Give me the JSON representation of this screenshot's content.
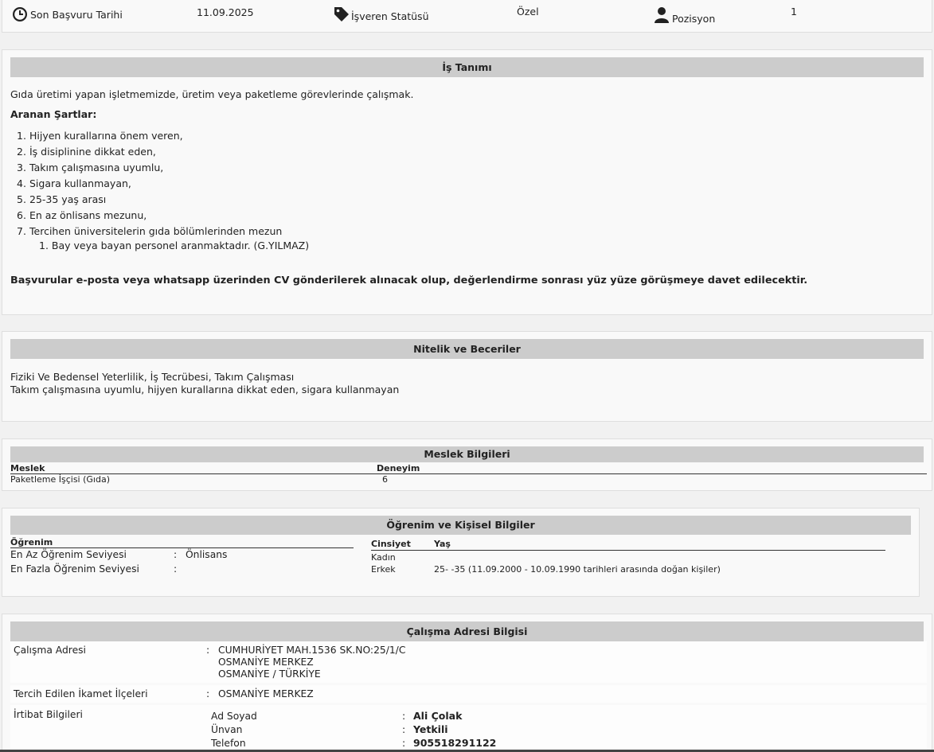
{
  "top_info": {
    "deadline_label": "Son Başvuru Tarihi",
    "deadline_value": "11.09.2025",
    "employer_status_label": "İşveren Statüsü",
    "employer_status_value": "Özel",
    "position_label": "Pozisyon",
    "position_value": "1",
    "icons": [
      "clock-icon",
      "tag-icon",
      "user-icon"
    ]
  },
  "job_description": {
    "title": "İş Tanımı",
    "intro": "Gıda üretimi yapan işletmemizde, üretim veya paketleme görevlerinde çalışmak.",
    "requirements_title": "Aranan Şartlar:",
    "requirements": [
      {
        "n": "1.",
        "text": "Hijyen kurallarına önem veren,"
      },
      {
        "n": "2.",
        "text": "İş disiplinine dikkat eden,"
      },
      {
        "n": "3.",
        "text": "Takım çalışmasına uyumlu,"
      },
      {
        "n": "4.",
        "text": "Sigara kullanmayan,"
      },
      {
        "n": "5.",
        "text": "25-35 yaş arası"
      },
      {
        "n": "6.",
        "text": "En az önlisans mezunu,"
      },
      {
        "n": "7.",
        "text": "Tercihen üniversitelerin gıda bölümlerinden mezun"
      }
    ],
    "sub_requirement": "1. Bay veya bayan personel aranmaktadır. (G.YILMAZ)",
    "closing": "Başvurular e-posta veya whatsapp üzerinden CV gönderilerek alınacak olup, değerlendirme sonrası yüz yüze görüşmeye davet edilecektir."
  },
  "skills": {
    "title": "Nitelik ve Beceriler",
    "line1": "Fiziki Ve Bedensel Yeterlilik, İş Tecrübesi, Takım Çalışması",
    "line2": "Takım çalışmasına uyumlu, hijyen kurallarına dikkat eden, sigara kullanmayan"
  },
  "occupation": {
    "title": "Meslek Bilgileri",
    "col_occupation": "Meslek",
    "col_experience": "Deneyim",
    "rows": [
      {
        "occupation": "Paketleme İşçisi (Gıda)",
        "experience": "6"
      }
    ]
  },
  "education": {
    "title": "Öğrenim ve Kişisel Bilgiler",
    "education_header": "Öğrenim",
    "min_label": "En Az Öğrenim Seviyesi",
    "min_colon": ":",
    "min_value": "Önlisans",
    "max_label": "En Fazla Öğrenim Seviyesi",
    "max_colon": ":",
    "max_value": "",
    "gender_header": "Cinsiyet",
    "age_header": "Yaş",
    "genders": [
      {
        "gender": "Kadın",
        "age": ""
      },
      {
        "gender": "Erkek",
        "age": "25- -35 (11.09.2000 - 10.09.1990 tarihleri arasında doğan kişiler)"
      }
    ]
  },
  "address": {
    "title": "Çalışma Adresi Bilgisi",
    "work_address_label": "Çalışma Adresi",
    "colon": ":",
    "work_address_line1": "CUMHURİYET MAH.1536 SK.NO:25/1/C",
    "work_address_line2": "OSMANİYE MERKEZ",
    "work_address_line3": "OSMANİYE / TÜRKİYE",
    "residence_label": "Tercih Edilen İkamet İlçeleri",
    "residence_value": "OSMANİYE MERKEZ",
    "contact_label": "İrtibat Bilgileri",
    "contact": {
      "name_label": "Ad Soyad",
      "name_value": "Ali Çolak",
      "title_label": "Ünvan",
      "title_value": "Yetkili",
      "phone_label": "Telefon",
      "phone_value": "905518291122"
    }
  }
}
